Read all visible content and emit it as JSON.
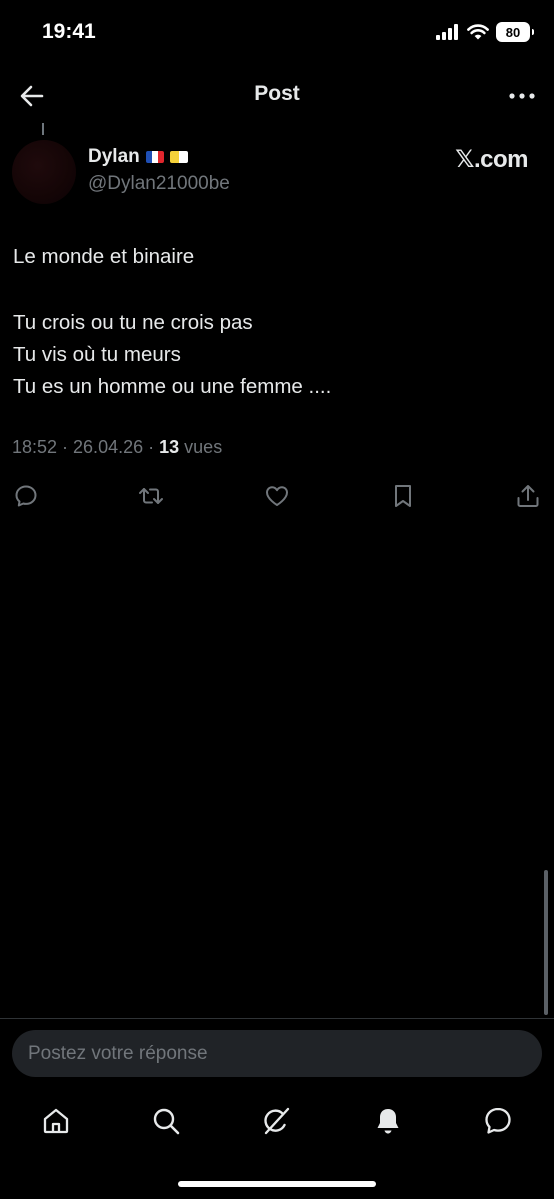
{
  "status_bar": {
    "time": "19:41",
    "battery": "80",
    "icons": [
      "cellular-signal-icon",
      "wifi-icon",
      "battery-icon"
    ]
  },
  "header": {
    "title": "Post",
    "back_icon": "arrow-left-icon",
    "more_icon": "more-horizontal-icon"
  },
  "post": {
    "author": {
      "name": "Dylan",
      "badges": [
        "flag-france",
        "flag-vatican"
      ],
      "handle": "@Dylan21000be"
    },
    "watermark": "𝕏.com",
    "body": [
      "Le monde et binaire",
      "",
      "Tu crois ou tu ne crois pas",
      "Tu vis où tu meurs",
      "Tu es un homme ou une femme ...."
    ],
    "meta": {
      "timestamp": "18:52 · 26.04.26 ·",
      "views_count": "13",
      "views_label": "vues"
    },
    "actions": [
      "reply-icon",
      "repost-icon",
      "like-icon",
      "bookmark-icon",
      "share-icon"
    ]
  },
  "reply": {
    "placeholder": "Postez votre réponse"
  },
  "tab_bar": {
    "items": [
      "home-icon",
      "search-icon",
      "grok-icon",
      "notifications-icon",
      "messages-icon"
    ]
  },
  "colors": {
    "background": "#000000",
    "text_primary": "#e7e9ea",
    "text_secondary": "#71767b",
    "input_background": "#202327",
    "divider": "#2f3336"
  }
}
